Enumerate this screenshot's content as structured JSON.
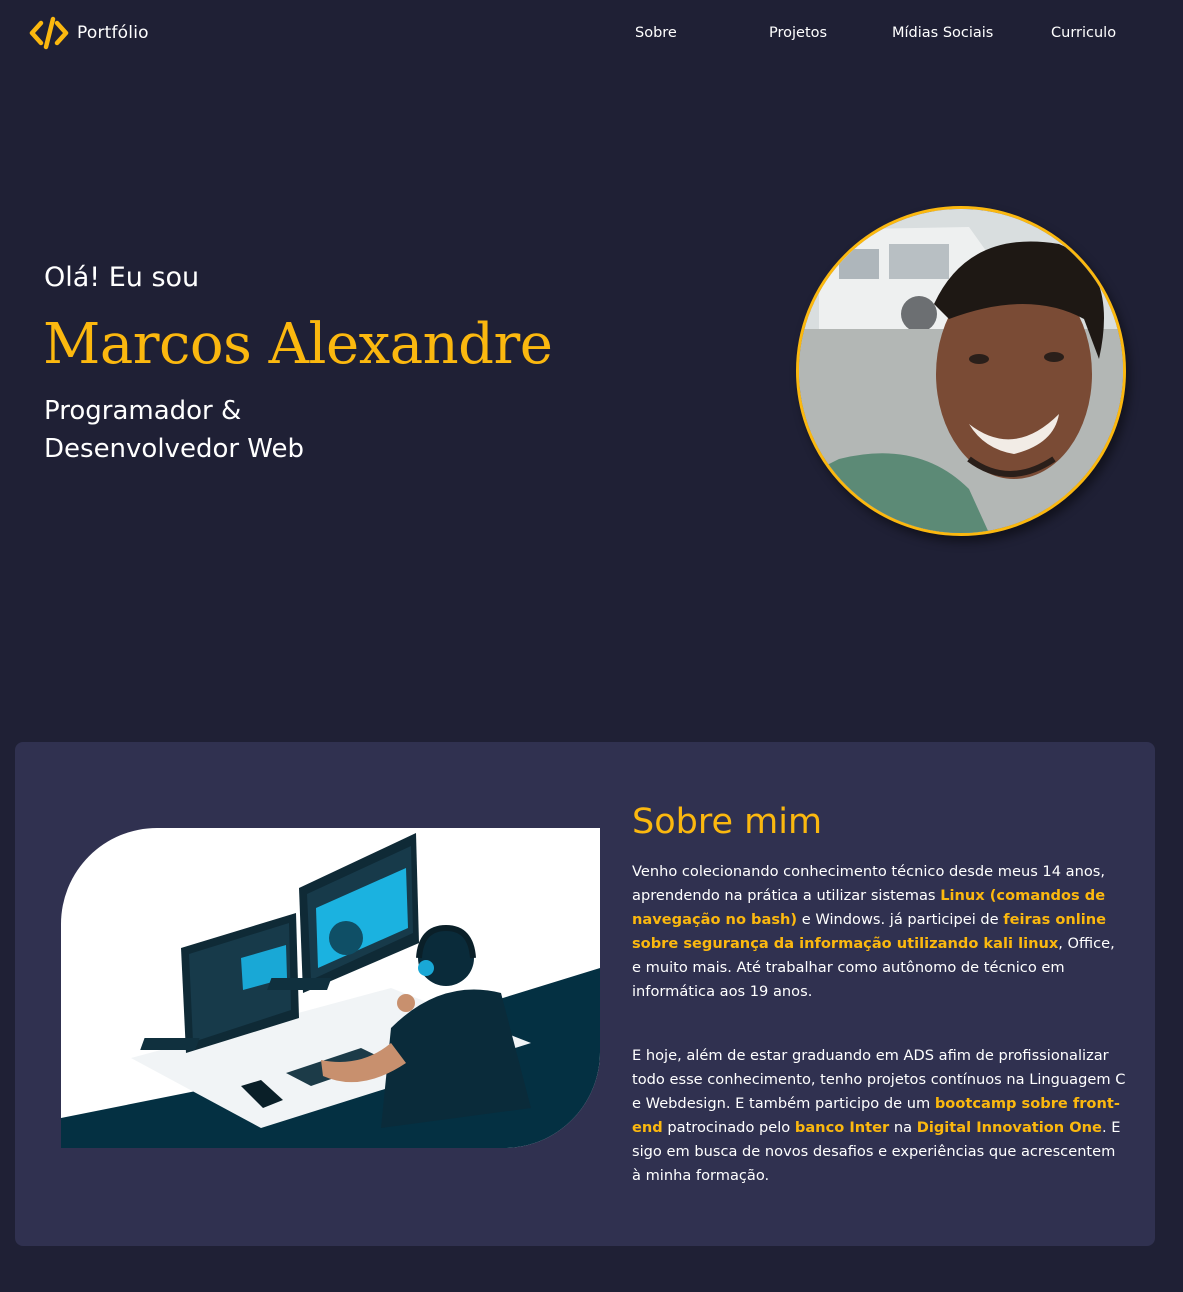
{
  "header": {
    "logo_icon": "code-brackets-icon",
    "logo_text": "Portfólio",
    "nav": [
      {
        "label": "Sobre"
      },
      {
        "label": "Projetos"
      },
      {
        "label": "Mídias Sociais"
      },
      {
        "label": "Curriculo"
      }
    ]
  },
  "hero": {
    "greeting": "Olá! Eu sou",
    "name": "Marcos Alexandre",
    "role_line1": "Programador &",
    "role_line2": "Desenvolvedor Web"
  },
  "about": {
    "title": "Sobre mim",
    "p1": [
      {
        "text": "Venho colecionando conhecimento técnico desde meus 14 anos, aprendendo na prática a utilizar sistemas ",
        "hl": false
      },
      {
        "text": "Linux (comandos de navegação no bash)",
        "hl": true
      },
      {
        "text": " e Windows. já participei de ",
        "hl": false
      },
      {
        "text": "feiras online sobre segurança da informação utilizando kali linux",
        "hl": true
      },
      {
        "text": ", Office, e muito mais. Até trabalhar como autônomo de técnico em informática aos 19 anos.",
        "hl": false
      }
    ],
    "p2": [
      {
        "text": "E hoje, além de estar graduando em ADS afim de profissionalizar todo esse conhecimento, tenho projetos contínuos na Linguagem C e Webdesign. E também participo de um ",
        "hl": false
      },
      {
        "text": "bootcamp sobre front-end",
        "hl": true
      },
      {
        "text": " patrocinado pelo ",
        "hl": false
      },
      {
        "text": "banco Inter",
        "hl": true
      },
      {
        "text": " na ",
        "hl": false
      },
      {
        "text": "Digital Innovation One",
        "hl": true
      },
      {
        "text": ". E sigo em busca de novos desafios e experiências que acrescentem à minha formação.",
        "hl": false
      }
    ]
  },
  "colors": {
    "background": "#1f2035",
    "panel": "#303150",
    "accent": "#fbb80f",
    "text": "#ffffff"
  }
}
